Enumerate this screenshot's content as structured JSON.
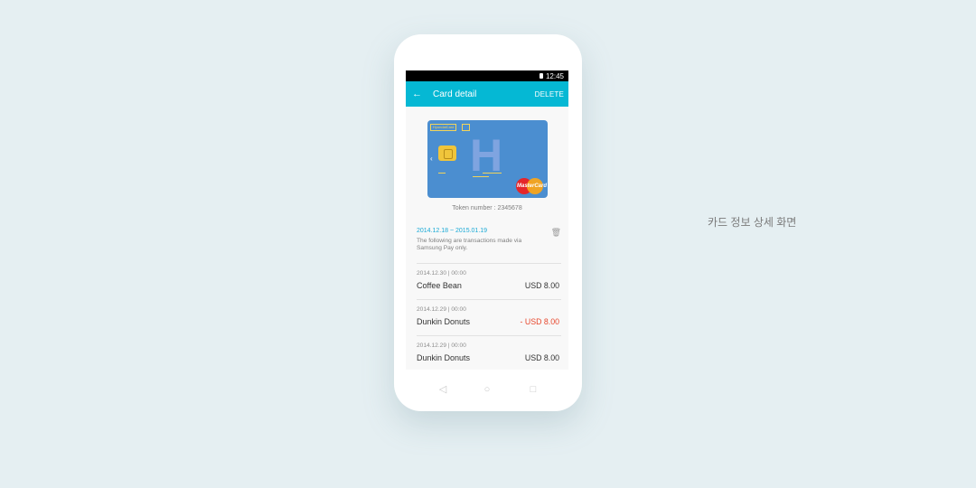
{
  "statusbar": {
    "time": "12:45"
  },
  "appbar": {
    "title": "Card detail",
    "delete_label": "DELETE"
  },
  "card": {
    "brand_text": "HyundaiCard",
    "network": "MasterCard",
    "token_text": "Token number : 2345678"
  },
  "history": {
    "range": "2014.12.18 ~ 2015.01.19",
    "note": "The following are transactions made via Samsung Pay only."
  },
  "transactions": [
    {
      "date": "2014.12.30 | 00:00",
      "merchant": "Coffee Bean",
      "amount": "USD 8.00"
    },
    {
      "date": "2014.12.29 | 00:00",
      "merchant": "Dunkin Donuts",
      "amount": "- USD 8.00"
    },
    {
      "date": "2014.12.29 | 00:00",
      "merchant": "Dunkin Donuts",
      "amount": "USD 8.00"
    }
  ],
  "caption": "카드 정보 상세 화면",
  "colors": {
    "appbar": "#05b8d4",
    "accent": "#19a9d6",
    "negative": "#e7472d",
    "card": "#4b8ed0",
    "background": "#e5eff2"
  }
}
